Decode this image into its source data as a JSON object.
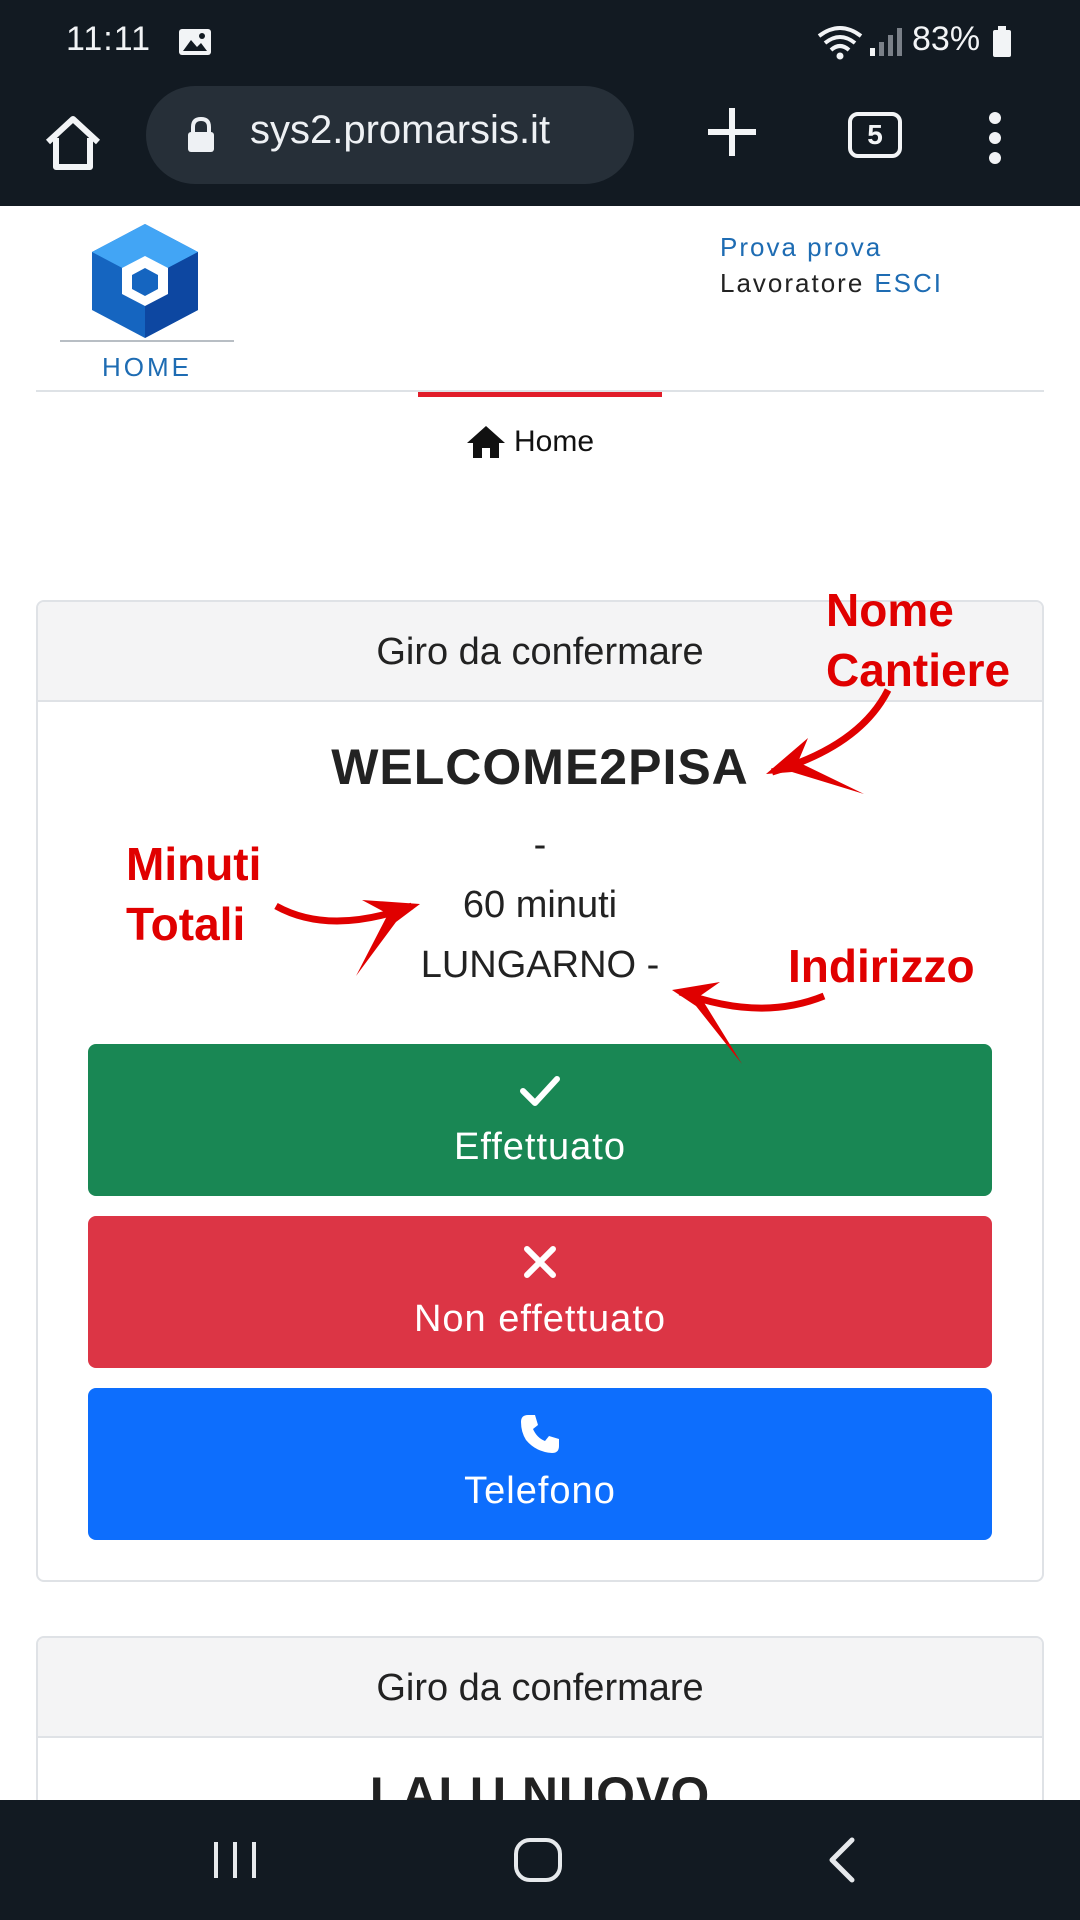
{
  "status_bar": {
    "time": "11:11",
    "battery": "83%",
    "icons": [
      "gallery-icon",
      "wifi-icon",
      "signal-icon",
      "battery-icon"
    ]
  },
  "browser": {
    "url": "sys2.promarsis.it",
    "tab_count": "5",
    "icons": [
      "home-icon",
      "lock-icon",
      "plus-icon",
      "more-vert-icon"
    ]
  },
  "header": {
    "home_link": "HOME",
    "user_name": "Prova prova",
    "user_role": "Lavoratore",
    "logout": "ESCI",
    "breadcrumb": "Home"
  },
  "cards": [
    {
      "header": "Giro da confermare",
      "site": "WELCOME2PISA",
      "dash": "-",
      "minutes": "60 minuti",
      "address": "LUNGARNO -",
      "buttons": {
        "done": "Effettuato",
        "not_done": "Non effettuato",
        "phone": "Telefono"
      }
    },
    {
      "header": "Giro da confermare",
      "site": "LALU NUOVO"
    }
  ],
  "annotations": {
    "site": "Nome\nCantiere",
    "minutes": "Minuti\nTotali",
    "address": "Indirizzo"
  },
  "colors": {
    "accent_red": "#e11d2a",
    "success": "#198754",
    "danger": "#dc3545",
    "primary": "#0d6efd",
    "link": "#1e6cb3",
    "annotation": "#e00000"
  }
}
